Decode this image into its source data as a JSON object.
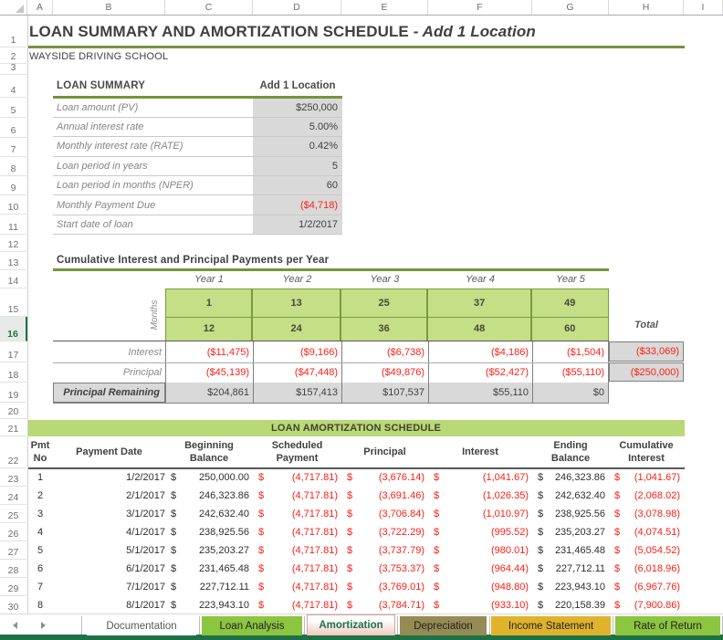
{
  "sheet": {
    "columns": [
      "A",
      "B",
      "C",
      "D",
      "E",
      "F",
      "G",
      "H",
      "I"
    ],
    "rows": [
      "1",
      "2",
      "3",
      "4",
      "5",
      "6",
      "7",
      "8",
      "9",
      "10",
      "11",
      "12",
      "13",
      "14",
      "15",
      "16",
      "17",
      "18",
      "19",
      "20",
      "21",
      "22",
      "23",
      "24",
      "25",
      "26",
      "27",
      "28",
      "29",
      "30"
    ],
    "selected_row": "16"
  },
  "title": {
    "main": "LOAN SUMMARY AND AMORTIZATION SCHEDULE",
    "suffix": " - Add 1 Location"
  },
  "company": "WAYSIDE DRIVING SCHOOL",
  "loan_summary": {
    "title": "LOAN SUMMARY",
    "scenario": "Add 1 Location",
    "rows": [
      {
        "label": "Loan amount (PV)",
        "value": "$250,000"
      },
      {
        "label": "Annual interest rate",
        "value": "5.00%"
      },
      {
        "label": "Monthly interest rate (RATE)",
        "value": "0.42%"
      },
      {
        "label": "Loan period in years",
        "value": "5"
      },
      {
        "label": "Loan period in months (NPER)",
        "value": "60"
      },
      {
        "label": "Monthly Payment Due",
        "value": "($4,718)"
      },
      {
        "label": "Start date of loan",
        "value": "1/2/2017"
      }
    ]
  },
  "cumulative": {
    "title": "Cumulative Interest and Principal Payments per Year",
    "months_label": "Months",
    "total_label": "Total",
    "years": [
      "Year 1",
      "Year 2",
      "Year 3",
      "Year 4",
      "Year 5"
    ],
    "month_start": [
      "1",
      "13",
      "25",
      "37",
      "49"
    ],
    "month_end": [
      "12",
      "24",
      "36",
      "48",
      "60"
    ],
    "interest": {
      "label": "Interest",
      "values": [
        "($11,475)",
        "($9,166)",
        "($6,738)",
        "($4,186)",
        "($1,504)"
      ],
      "total": "($33,069)"
    },
    "principal": {
      "label": "Principal",
      "values": [
        "($45,139)",
        "($47,448)",
        "($49,876)",
        "($52,427)",
        "($55,110)"
      ],
      "total": "($250,000)"
    },
    "remaining": {
      "label": "Principal Remaining",
      "values": [
        "$204,861",
        "$157,413",
        "$107,537",
        "$55,110",
        "$0"
      ]
    }
  },
  "amortization": {
    "title": "LOAN AMORTIZATION SCHEDULE",
    "currency": "$",
    "headers": [
      [
        "Pmt",
        "No"
      ],
      [
        "Payment Date"
      ],
      [
        "Beginning",
        "Balance"
      ],
      [
        "Scheduled",
        "Payment"
      ],
      [
        "Principal"
      ],
      [
        "Interest"
      ],
      [
        "Ending",
        "Balance"
      ],
      [
        "Cumulative",
        "Interest"
      ]
    ],
    "rows": [
      {
        "no": "1",
        "date": "1/2/2017",
        "begin": "250,000.00",
        "sched": "(4,717.81)",
        "principal": "(3,676.14)",
        "interest": "(1,041.67)",
        "end": "246,323.86",
        "cum": "(1,041.67)"
      },
      {
        "no": "2",
        "date": "2/1/2017",
        "begin": "246,323.86",
        "sched": "(4,717.81)",
        "principal": "(3,691.46)",
        "interest": "(1,026.35)",
        "end": "242,632.40",
        "cum": "(2,068.02)"
      },
      {
        "no": "3",
        "date": "3/1/2017",
        "begin": "242,632.40",
        "sched": "(4,717.81)",
        "principal": "(3,706.84)",
        "interest": "(1,010.97)",
        "end": "238,925.56",
        "cum": "(3,078.98)"
      },
      {
        "no": "4",
        "date": "4/1/2017",
        "begin": "238,925.56",
        "sched": "(4,717.81)",
        "principal": "(3,722.29)",
        "interest": "(995.52)",
        "end": "235,203.27",
        "cum": "(4,074.51)"
      },
      {
        "no": "5",
        "date": "5/1/2017",
        "begin": "235,203.27",
        "sched": "(4,717.81)",
        "principal": "(3,737.79)",
        "interest": "(980.01)",
        "end": "231,465.48",
        "cum": "(5,054.52)"
      },
      {
        "no": "6",
        "date": "6/1/2017",
        "begin": "231,465.48",
        "sched": "(4,717.81)",
        "principal": "(3,753.37)",
        "interest": "(964.44)",
        "end": "227,712.11",
        "cum": "(6,018.96)"
      },
      {
        "no": "7",
        "date": "7/1/2017",
        "begin": "227,712.11",
        "sched": "(4,717.81)",
        "principal": "(3,769.01)",
        "interest": "(948.80)",
        "end": "223,943.10",
        "cum": "(6,967.76)"
      },
      {
        "no": "8",
        "date": "8/1/2017",
        "begin": "223,943.10",
        "sched": "(4,717.81)",
        "principal": "(3,784.71)",
        "interest": "(933.10)",
        "end": "220,158.39",
        "cum": "(7,900.86)"
      }
    ]
  },
  "tabs": {
    "items": [
      {
        "label": "Documentation",
        "bg": "#FFFFFF",
        "fg": "#595959",
        "active": false
      },
      {
        "label": "Loan Analysis",
        "bg": "#8CC540",
        "fg": "#1F1F1F",
        "active": false
      },
      {
        "label": "Amortization",
        "bg": "#F1C8C1",
        "fg": "#1E7145",
        "active": true
      },
      {
        "label": "Depreciation",
        "bg": "#958B55",
        "fg": "#1F1F1F",
        "active": false
      },
      {
        "label": "Income Statement",
        "bg": "#DFB32C",
        "fg": "#1F1F1F",
        "active": false
      },
      {
        "label": "Rate of Return",
        "bg": "#8CC540",
        "fg": "#1F1F1F",
        "active": false
      }
    ]
  },
  "colors": {
    "accent_green": "#76933C",
    "cell_green": "#C5DF87",
    "bar_green": "#B9D977",
    "negative_red": "#FE1E14",
    "gray_fill": "#D9D9D9",
    "label_gray": "#848484",
    "text_dark": "#404040",
    "statusbar_green": "#1E7145",
    "selected_header_green": "#217346"
  }
}
